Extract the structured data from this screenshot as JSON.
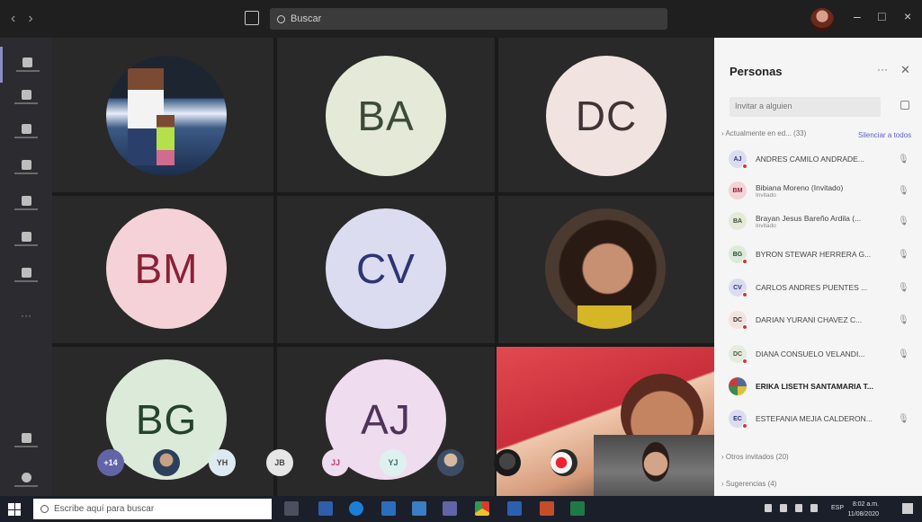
{
  "search": {
    "placeholder": "Buscar"
  },
  "window": {
    "minimize": "–",
    "maximize": "□",
    "close": "×"
  },
  "rail": [
    {
      "name": "activity",
      "icon": "bell-icon"
    },
    {
      "name": "chat",
      "icon": "chat-icon"
    },
    {
      "name": "teams",
      "icon": "teams-icon"
    },
    {
      "name": "assignments",
      "icon": "assignments-icon"
    },
    {
      "name": "calendar",
      "icon": "calendar-icon"
    },
    {
      "name": "calls",
      "icon": "phone-icon"
    },
    {
      "name": "files",
      "icon": "files-icon"
    }
  ],
  "rail_more": "···",
  "stage": {
    "tiles": [
      {
        "initials": "BA",
        "bg": "#e4ead7",
        "fg": "#3d4a3a"
      },
      {
        "initials": "DC",
        "bg": "#f1e4e0",
        "fg": "#3e3436"
      },
      {
        "initials": "BM",
        "bg": "#f5d2d8",
        "fg": "#8a2137"
      },
      {
        "initials": "CV",
        "bg": "#dcdcf1",
        "fg": "#2f3572"
      },
      {
        "initials": "BG",
        "bg": "#dcebd9",
        "fg": "#24432f"
      },
      {
        "initials": "AJ",
        "bg": "#f0dcef",
        "fg": "#4f3358"
      }
    ],
    "strip": [
      {
        "initials": "+14",
        "bg": "#6264a7",
        "fg": "#ffffff"
      },
      {
        "initials": "",
        "bg": "#8a8a8a",
        "fg": "#ffffff"
      },
      {
        "initials": "YH",
        "bg": "#ddeaf1",
        "fg": "#444"
      },
      {
        "initials": "JB",
        "bg": "#e6e6e6",
        "fg": "#444"
      },
      {
        "initials": "JJ",
        "bg": "#f0dcef",
        "fg": "#b2436e"
      },
      {
        "initials": "YJ",
        "bg": "#dff1ef",
        "fg": "#2f6c6a"
      },
      {
        "initials": "",
        "bg": "#6b7a8c",
        "fg": "#ffffff"
      }
    ]
  },
  "panel": {
    "title": "Personas",
    "more": "···",
    "invite_placeholder": "Invitar a alguien",
    "section_active": "Actualmente en ed... (33)",
    "mute_all": "Silenciar a todos",
    "people": [
      {
        "initials": "AJ",
        "name": "ANDRES CAMILO ANDRADE...",
        "sub": "",
        "bg": "#dcdcf1",
        "fg": "#2f3572"
      },
      {
        "initials": "BM",
        "name": "Bibiana Moreno (Invitado)",
        "sub": "Invitado",
        "bg": "#f5d2d8",
        "fg": "#8a2137"
      },
      {
        "initials": "BA",
        "name": "Brayan Jesus Bareño Ardila (...",
        "sub": "Invitado",
        "bg": "#e4ead7",
        "fg": "#3d4a3a"
      },
      {
        "initials": "BG",
        "name": "BYRON STEWAR HERRERA G...",
        "sub": "",
        "bg": "#dcebd9",
        "fg": "#24432f"
      },
      {
        "initials": "CV",
        "name": "CARLOS ANDRES PUENTES ...",
        "sub": "",
        "bg": "#dcdcf1",
        "fg": "#2f3572"
      },
      {
        "initials": "DC",
        "name": "DARIAN YURANI CHAVEZ C...",
        "sub": "",
        "bg": "#f1e4e0",
        "fg": "#3e3436"
      },
      {
        "initials": "DC",
        "name": "DIANA CONSUELO VELANDI...",
        "sub": "",
        "bg": "#e6ebe0",
        "fg": "#4b5b3c"
      },
      {
        "initials": "",
        "name": "ERIKA LISETH SANTAMARIA T...",
        "sub": "",
        "bg": "#4e6a9e",
        "fg": "#ffffff"
      },
      {
        "initials": "EC",
        "name": "ESTEFANIA MEJIA CALDERON...",
        "sub": "",
        "bg": "#dcdcf1",
        "fg": "#2f3572"
      }
    ],
    "section_others": "Otros invitados (20)",
    "section_suggestions": "Sugerencias (4)"
  },
  "taskbar": {
    "search_placeholder": "Escribe aquí para buscar",
    "lang": "ESP",
    "time": "8:02 a.m.",
    "date": "11/08/2020"
  }
}
